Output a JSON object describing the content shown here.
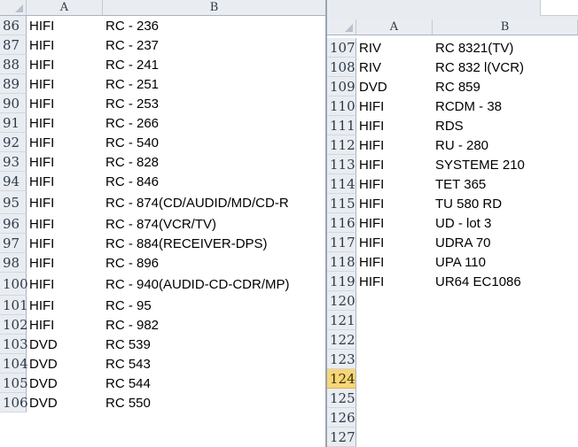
{
  "left_pane": {
    "col_a": "A",
    "col_b": "B",
    "rows": [
      {
        "n": "86",
        "a": "HIFI",
        "b": "RC - 236"
      },
      {
        "n": "87",
        "a": "HIFI",
        "b": "RC - 237"
      },
      {
        "n": "88",
        "a": "HIFI",
        "b": "RC - 241"
      },
      {
        "n": "89",
        "a": "HIFI",
        "b": "RC - 251"
      },
      {
        "n": "90",
        "a": "HIFI",
        "b": "RC - 253"
      },
      {
        "n": "91",
        "a": "HIFI",
        "b": "RC - 266"
      },
      {
        "n": "92",
        "a": "HIFI",
        "b": "RC - 540"
      },
      {
        "n": "93",
        "a": "HIFI",
        "b": "RC - 828"
      },
      {
        "n": "94",
        "a": "HIFI",
        "b": "RC - 846"
      },
      {
        "n": "95",
        "a": "HIFI",
        "b": "RC - 874(CD/AUDID/MD/CD-R"
      },
      {
        "n": "96",
        "a": "HIFI",
        "b": "RC - 874(VCR/TV)"
      },
      {
        "n": "97",
        "a": "HIFI",
        "b": "RC - 884(RECEIVER-DPS)"
      },
      {
        "n": "98",
        "a": "HIFI",
        "b": "RC - 896"
      },
      {
        "n": "100",
        "a": "HIFI",
        "b": "RC - 940(AUDID-CD-CDR/MP)"
      },
      {
        "n": "101",
        "a": "HIFI",
        "b": "RC - 95"
      },
      {
        "n": "102",
        "a": "HIFI",
        "b": "RC - 982"
      },
      {
        "n": "103",
        "a": "DVD",
        "b": "RC 539"
      },
      {
        "n": "104",
        "a": "DVD",
        "b": "RC 543"
      },
      {
        "n": "105",
        "a": "DVD",
        "b": "RC 544"
      },
      {
        "n": "106",
        "a": "DVD",
        "b": "RC 550"
      }
    ]
  },
  "right_pane": {
    "col_a": "A",
    "col_b": "B",
    "selected_row": "124",
    "rows": [
      {
        "n": "107",
        "a": "RIV",
        "b": "RC 8321(TV)"
      },
      {
        "n": "108",
        "a": "RIV",
        "b": "RC 832 l(VCR)"
      },
      {
        "n": "109",
        "a": "DVD",
        "b": "RC 859"
      },
      {
        "n": "110",
        "a": "HIFI",
        "b": "RCDM - 38"
      },
      {
        "n": "111",
        "a": "HIFI",
        "b": "RDS"
      },
      {
        "n": "112",
        "a": "HIFI",
        "b": "RU - 280"
      },
      {
        "n": "113",
        "a": "HIFI",
        "b": "SYSTEME 210"
      },
      {
        "n": "114",
        "a": "HIFI",
        "b": "TET 365"
      },
      {
        "n": "115",
        "a": "HIFI",
        "b": "TU 580 RD"
      },
      {
        "n": "116",
        "a": "HIFI",
        "b": "UD - lot 3"
      },
      {
        "n": "117",
        "a": "HIFI",
        "b": "UDRA 70"
      },
      {
        "n": "118",
        "a": "HIFI",
        "b": "UPA 110"
      },
      {
        "n": "119",
        "a": "HIFI",
        "b": "UR64 EC1086"
      },
      {
        "n": "120",
        "a": "",
        "b": ""
      },
      {
        "n": "121",
        "a": "",
        "b": ""
      },
      {
        "n": "122",
        "a": "",
        "b": ""
      },
      {
        "n": "123",
        "a": "",
        "b": ""
      },
      {
        "n": "124",
        "a": "",
        "b": ""
      },
      {
        "n": "125",
        "a": "",
        "b": ""
      },
      {
        "n": "126",
        "a": "",
        "b": ""
      },
      {
        "n": "127",
        "a": "",
        "b": ""
      }
    ]
  }
}
